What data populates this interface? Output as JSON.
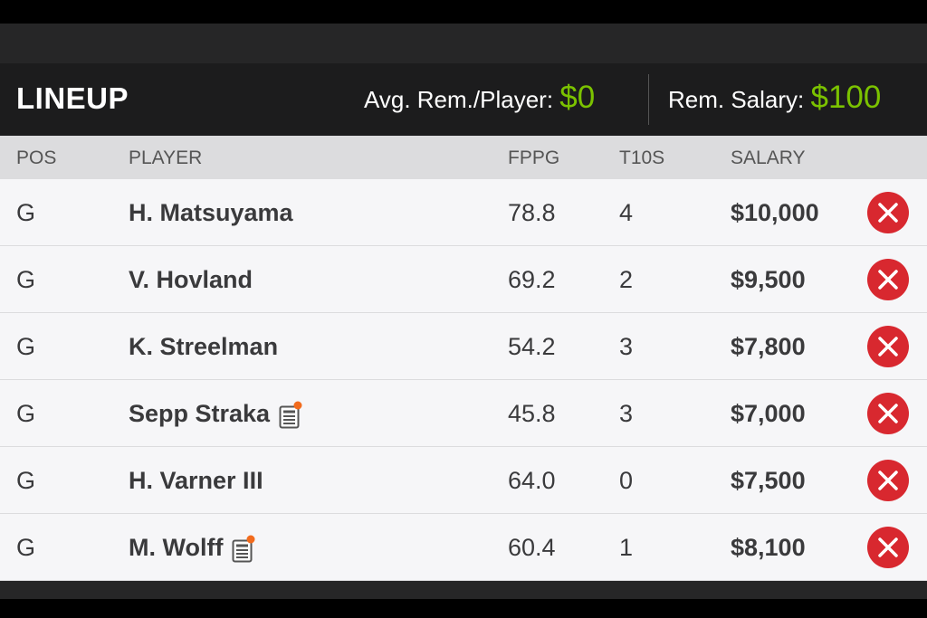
{
  "header": {
    "title": "LINEUP",
    "avg_label": "Avg. Rem./Player: ",
    "avg_value": "$0",
    "rem_label": "Rem. Salary: ",
    "rem_value": "$100"
  },
  "columns": {
    "pos": "POS",
    "player": "PLAYER",
    "fppg": "FPPG",
    "t10s": "T10S",
    "salary": "SALARY"
  },
  "rows": [
    {
      "pos": "G",
      "player": "H. Matsuyama",
      "fppg": "78.8",
      "t10s": "4",
      "salary": "$10,000",
      "news": false
    },
    {
      "pos": "G",
      "player": "V. Hovland",
      "fppg": "69.2",
      "t10s": "2",
      "salary": "$9,500",
      "news": false
    },
    {
      "pos": "G",
      "player": "K. Streelman",
      "fppg": "54.2",
      "t10s": "3",
      "salary": "$7,800",
      "news": false
    },
    {
      "pos": "G",
      "player": "Sepp Straka",
      "fppg": "45.8",
      "t10s": "3",
      "salary": "$7,000",
      "news": true
    },
    {
      "pos": "G",
      "player": "H. Varner III",
      "fppg": "64.0",
      "t10s": "0",
      "salary": "$7,500",
      "news": false
    },
    {
      "pos": "G",
      "player": "M. Wolff",
      "fppg": "60.4",
      "t10s": "1",
      "salary": "$8,100",
      "news": true
    }
  ],
  "colors": {
    "accent_green": "#7bc200",
    "remove_red": "#d8282f",
    "news_dot": "#f26b1d"
  },
  "icons": {
    "remove": "remove-x-icon",
    "news": "player-news-icon"
  }
}
